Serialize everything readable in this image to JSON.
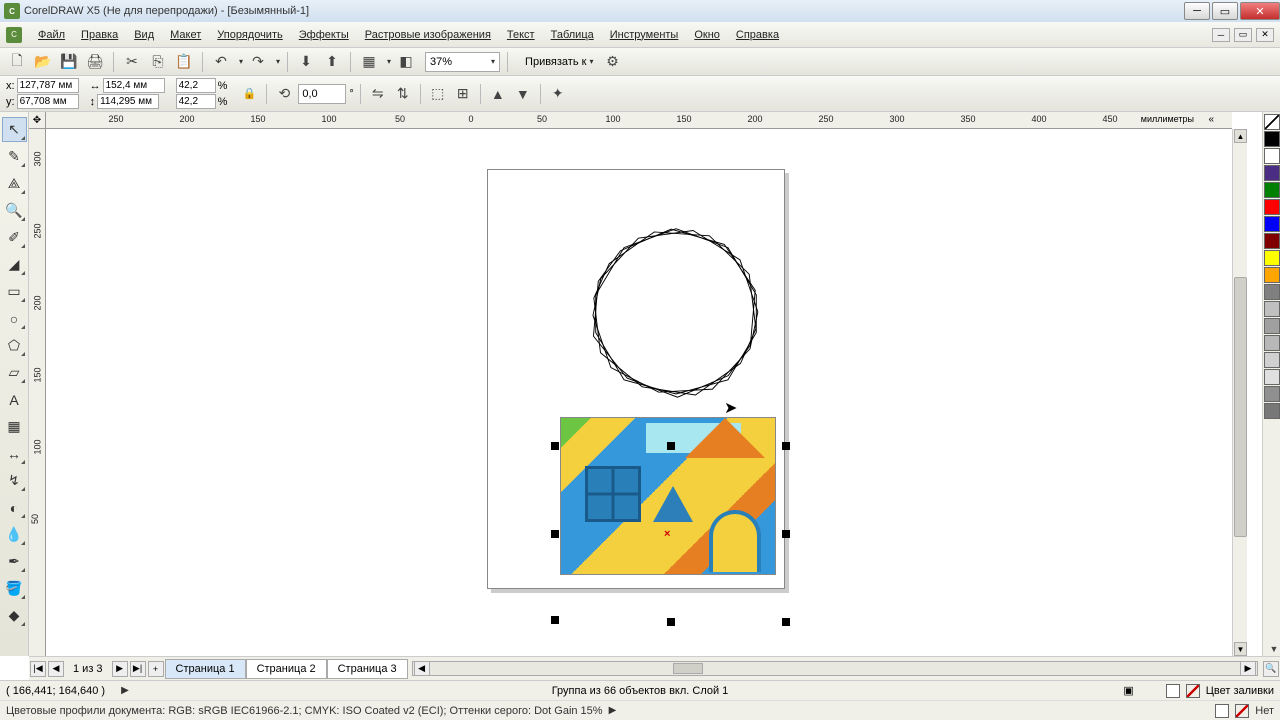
{
  "title": "CorelDRAW X5 (Не для перепродажи) - [Безымянный-1]",
  "menu": {
    "file": "Файл",
    "edit": "Правка",
    "view": "Вид",
    "layout": "Макет",
    "arrange": "Упорядочить",
    "effects": "Эффекты",
    "bitmaps": "Растровые изображения",
    "text": "Текст",
    "table": "Таблица",
    "tools": "Инструменты",
    "window": "Окно",
    "help": "Справка"
  },
  "toolbar": {
    "zoom": "37%",
    "snap": "Привязать к"
  },
  "propbar": {
    "x_label": "x:",
    "y_label": "y:",
    "x": "127,787 мм",
    "y": "67,708 мм",
    "w": "152,4 мм",
    "h": "114,295 мм",
    "scale_x": "42,2",
    "scale_y": "42,2",
    "pct": "%",
    "rot": "0,0",
    "deg": "°"
  },
  "ruler": {
    "unit": "миллиметры",
    "h": [
      "250",
      "200",
      "150",
      "100",
      "50",
      "0",
      "50",
      "100",
      "150",
      "200",
      "250",
      "300",
      "350",
      "400",
      "450"
    ],
    "v": [
      "300",
      "250",
      "200",
      "150",
      "100",
      "50"
    ]
  },
  "pagenav": {
    "counter": "1 из 3",
    "p1": "Страница 1",
    "p2": "Страница 2",
    "p3": "Страница 3"
  },
  "status": {
    "coords": "( 166,441; 164,640 )",
    "selection": "Группа из 66 объектов вкл. Слой 1",
    "fill": "Цвет заливки",
    "outline": "Нет",
    "profiles": "Цветовые профили документа: RGB: sRGB IEC61966-2.1; CMYK: ISO Coated v2 (ECI); Оттенки серого: Dot Gain 15%"
  },
  "colors": [
    "#000000",
    "#ffffff",
    "#4b2e83",
    "#008000",
    "#ff0000",
    "#0000ff",
    "#800000",
    "#ffff00",
    "#ffa500",
    "#808080",
    "#c0c0c0",
    "#a0a0a0",
    "#b8b8b8",
    "#d0d0d0",
    "#e0e0e0",
    "#909090",
    "#787878"
  ]
}
